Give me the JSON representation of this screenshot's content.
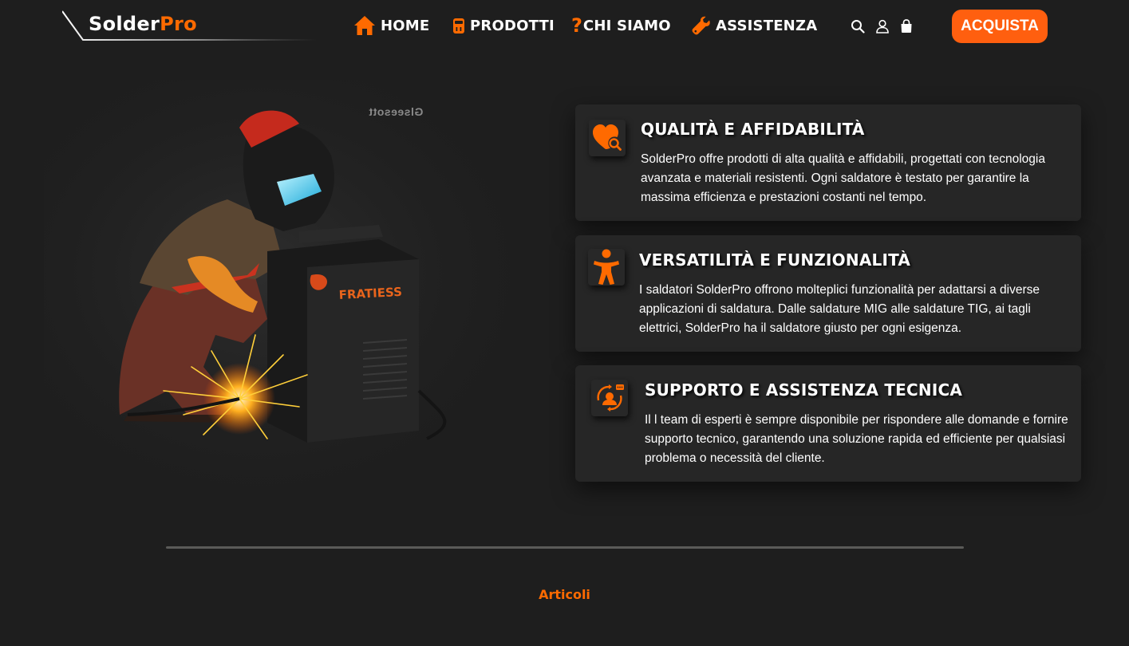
{
  "brand": {
    "name_part1": "Solder",
    "name_part2": "Pro"
  },
  "nav": [
    {
      "label": "HOME",
      "icon": "home-icon"
    },
    {
      "label": "PRODOTTI",
      "icon": "welding-machine-icon"
    },
    {
      "label": "CHI SIAMO",
      "icon": "question-icon"
    },
    {
      "label": "ASSISTENZA",
      "icon": "wrench-icon"
    }
  ],
  "header_icons": [
    "search-icon",
    "user-icon",
    "cart-icon"
  ],
  "cta": {
    "label": "ACQUISTA"
  },
  "hero": {
    "watermark": "Glseesott",
    "product_label": "FRATIESS"
  },
  "features": [
    {
      "title": "QUALITÀ E AFFIDABILITÀ",
      "icon": "heart-search-icon",
      "text": "SolderPro offre prodotti di alta qualità e affidabili, progettati con tecnologia avanzata e materiali resistenti. Ogni saldatore è testato per garantire la massima efficienza e prestazioni costanti nel tempo."
    },
    {
      "title": "VERSATILITÀ E FUNZIONALITÀ",
      "icon": "person-icon",
      "text": "I saldatori SolderPro offrono molteplici funzionalità per adattarsi a diverse applicazioni di saldatura. Dalle saldature MIG alle saldature TIG, ai tagli elettrici, SolderPro ha il saldatore giusto per ogni esigenza."
    },
    {
      "title": "SUPPORTO E ASSISTENZA TECNICA",
      "icon": "support-agent-icon",
      "text": "Il l team di esperti è sempre disponibile per rispondere alle domande e fornire supporto tecnico, garantendo una soluzione rapida ed efficiente per qualsiasi problema o necessità del cliente."
    }
  ],
  "articles": {
    "label": "Articoli"
  },
  "colors": {
    "accent": "#ff6a00",
    "button": "#ff5f0f",
    "background": "#1e1e1e",
    "card": "#262626"
  }
}
